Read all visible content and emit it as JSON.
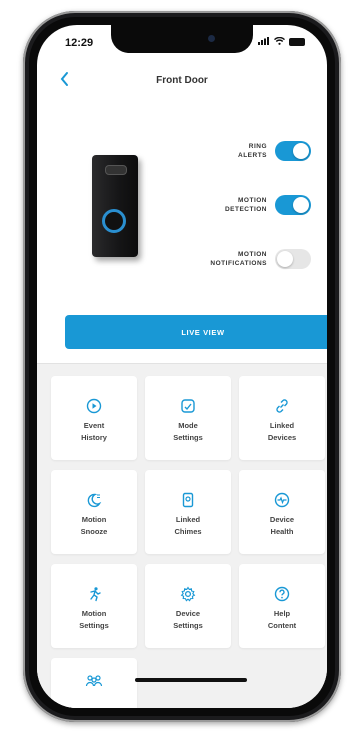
{
  "status_bar": {
    "time": "12:29",
    "signal": "•••",
    "wifi": "◠"
  },
  "header": {
    "title": "Front Door",
    "back_icon": "chevron-left-icon"
  },
  "toggles": [
    {
      "label_line1": "RING",
      "label_line2": "ALERTS",
      "state": "on"
    },
    {
      "label_line1": "MOTION",
      "label_line2": "DETECTION",
      "state": "on"
    },
    {
      "label_line1": "MOTION",
      "label_line2": "NOTIFICATIONS",
      "state": "off"
    }
  ],
  "live_view": {
    "label": "LIVE VIEW"
  },
  "tiles": [
    {
      "line1": "Event",
      "line2": "History",
      "icon": "play-circle-icon"
    },
    {
      "line1": "Mode",
      "line2": "Settings",
      "icon": "mode-shield-icon"
    },
    {
      "line1": "Linked",
      "line2": "Devices",
      "icon": "link-icon"
    },
    {
      "line1": "Motion",
      "line2": "Snooze",
      "icon": "moon-snooze-icon"
    },
    {
      "line1": "Linked",
      "line2": "Chimes",
      "icon": "chime-icon"
    },
    {
      "line1": "Device",
      "line2": "Health",
      "icon": "pulse-icon"
    },
    {
      "line1": "Motion",
      "line2": "Settings",
      "icon": "running-person-icon"
    },
    {
      "line1": "Device",
      "line2": "Settings",
      "icon": "gear-icon"
    },
    {
      "line1": "Help",
      "line2": "Content",
      "icon": "help-circle-icon"
    },
    {
      "line1": "",
      "line2": "",
      "icon": "people-icon"
    }
  ],
  "colors": {
    "accent": "#1998d5",
    "tile_bg": "#ffffff",
    "grid_bg": "#f1f1f1"
  }
}
